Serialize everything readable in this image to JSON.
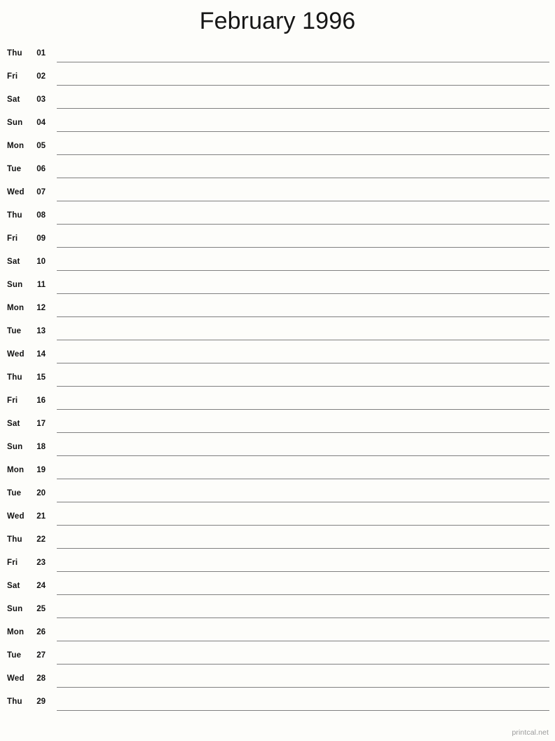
{
  "page": {
    "title": "February 1996",
    "month_name": "February",
    "year": "1996",
    "background_color": "#fdfdfa",
    "rule_color": "#808080",
    "text_color": "#111111"
  },
  "watermark": {
    "label": "printcal.net",
    "color": "#9a9a9a"
  },
  "calendar": {
    "layout": "single-column-notes-list",
    "days_in_month": 29,
    "first_weekday": "Thu",
    "rows": [
      {
        "weekday": "Thu",
        "date": "01"
      },
      {
        "weekday": "Fri",
        "date": "02"
      },
      {
        "weekday": "Sat",
        "date": "03"
      },
      {
        "weekday": "Sun",
        "date": "04"
      },
      {
        "weekday": "Mon",
        "date": "05"
      },
      {
        "weekday": "Tue",
        "date": "06"
      },
      {
        "weekday": "Wed",
        "date": "07"
      },
      {
        "weekday": "Thu",
        "date": "08"
      },
      {
        "weekday": "Fri",
        "date": "09"
      },
      {
        "weekday": "Sat",
        "date": "10"
      },
      {
        "weekday": "Sun",
        "date": "11"
      },
      {
        "weekday": "Mon",
        "date": "12"
      },
      {
        "weekday": "Tue",
        "date": "13"
      },
      {
        "weekday": "Wed",
        "date": "14"
      },
      {
        "weekday": "Thu",
        "date": "15"
      },
      {
        "weekday": "Fri",
        "date": "16"
      },
      {
        "weekday": "Sat",
        "date": "17"
      },
      {
        "weekday": "Sun",
        "date": "18"
      },
      {
        "weekday": "Mon",
        "date": "19"
      },
      {
        "weekday": "Tue",
        "date": "20"
      },
      {
        "weekday": "Wed",
        "date": "21"
      },
      {
        "weekday": "Thu",
        "date": "22"
      },
      {
        "weekday": "Fri",
        "date": "23"
      },
      {
        "weekday": "Sat",
        "date": "24"
      },
      {
        "weekday": "Sun",
        "date": "25"
      },
      {
        "weekday": "Mon",
        "date": "26"
      },
      {
        "weekday": "Tue",
        "date": "27"
      },
      {
        "weekday": "Wed",
        "date": "28"
      },
      {
        "weekday": "Thu",
        "date": "29"
      }
    ]
  }
}
